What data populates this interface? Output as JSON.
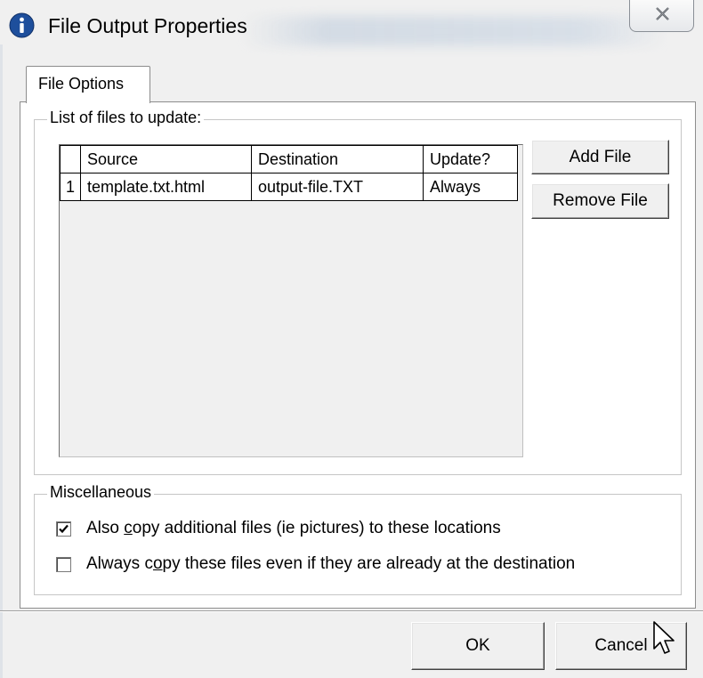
{
  "window": {
    "title": "File Output Properties",
    "title_icon": "info-icon",
    "close_icon": "close-icon"
  },
  "tabs": [
    {
      "label": "File Options",
      "selected": true
    }
  ],
  "files_group": {
    "label": "List of files to update:",
    "columns": [
      "Source",
      "Destination",
      "Update?"
    ],
    "rows": [
      {
        "num": "1",
        "source": "template.txt.html",
        "destination": "output-file.TXT",
        "update": "Always"
      }
    ],
    "add_button": "Add File",
    "remove_button": "Remove File"
  },
  "misc_group": {
    "label": "Miscellaneous",
    "options": [
      {
        "label_pre": "Also ",
        "label_u": "c",
        "label_post": "opy additional files (ie pictures) to these locations",
        "checked": true
      },
      {
        "label_pre": "Always c",
        "label_u": "o",
        "label_post": "py these files even if they are already at the destination",
        "checked": false
      }
    ]
  },
  "footer": {
    "ok_label": "OK",
    "cancel_label": "Cancel"
  },
  "colors": {
    "info_icon_fill": "#1e4f9c",
    "dialog_bg": "#f0f0f0",
    "panel_bg": "#ffffff"
  }
}
